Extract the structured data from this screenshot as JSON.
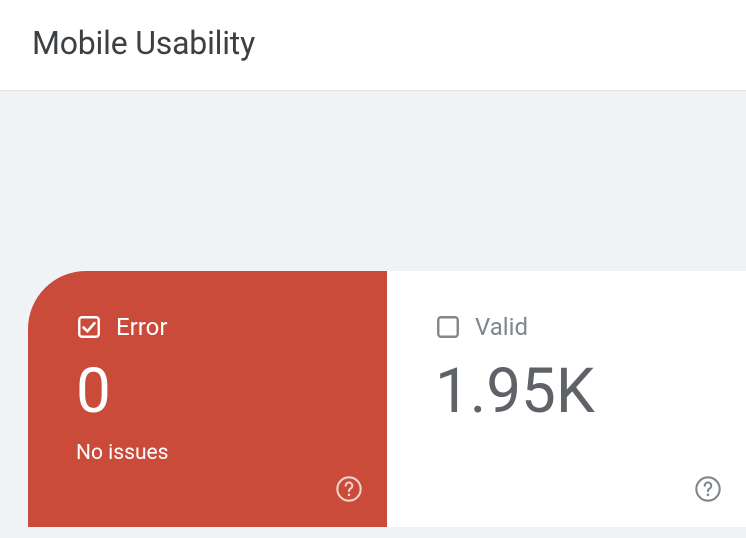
{
  "header": {
    "title": "Mobile Usability"
  },
  "cards": {
    "error": {
      "label": "Error",
      "value": "0",
      "subtext": "No issues",
      "checked": true
    },
    "valid": {
      "label": "Valid",
      "value": "1.95K",
      "checked": false
    }
  }
}
